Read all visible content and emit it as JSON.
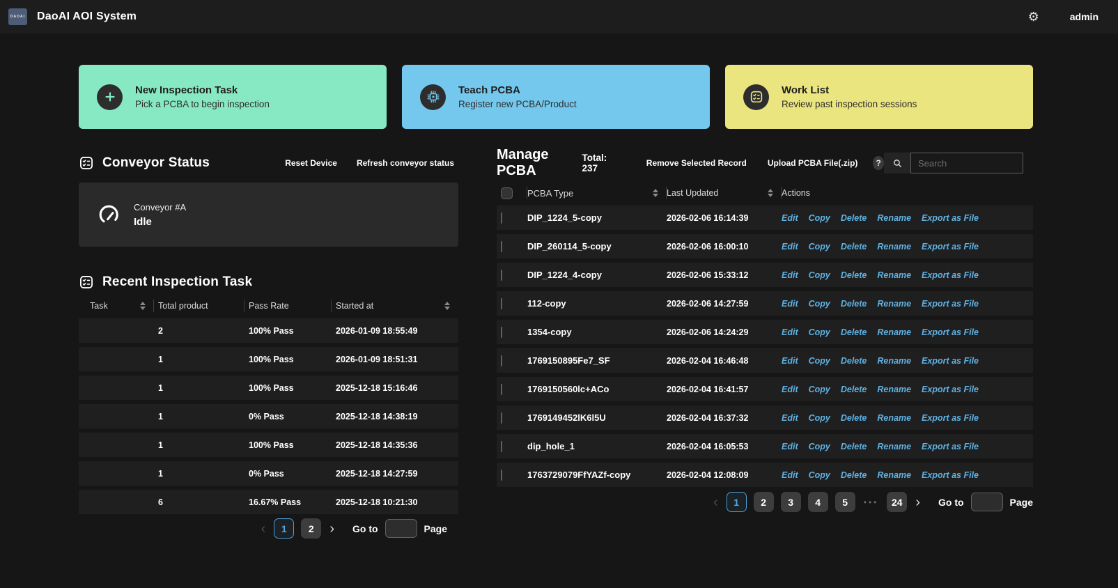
{
  "header": {
    "logo_text": "DAOAI",
    "title": "DaoAI AOI System",
    "user": "admin"
  },
  "icons": {
    "gear": "⚙",
    "help": "?",
    "prev": "‹",
    "next": "›"
  },
  "cards": [
    {
      "title": "New Inspection Task",
      "subtitle": "Pick a PCBA to begin inspection",
      "bg": "#87e9c3"
    },
    {
      "title": "Teach PCBA",
      "subtitle": "Register new PCBA/Product",
      "bg": "#74c8ed"
    },
    {
      "title": "Work List",
      "subtitle": "Review past inspection sessions",
      "bg": "#ebe57f"
    }
  ],
  "conveyor": {
    "heading": "Conveyor Status",
    "reset_label": "Reset Device",
    "refresh_label": "Refresh conveyor status",
    "device_name": "Conveyor #A",
    "device_status": "Idle"
  },
  "recent": {
    "heading": "Recent Inspection Task",
    "columns": [
      "Task",
      "Total product",
      "Pass Rate",
      "Started at"
    ],
    "rows": [
      {
        "task": "",
        "total": "2",
        "rate": "100% Pass",
        "started": "2026-01-09 18:55:49"
      },
      {
        "task": "",
        "total": "1",
        "rate": "100% Pass",
        "started": "2026-01-09 18:51:31"
      },
      {
        "task": "",
        "total": "1",
        "rate": "100% Pass",
        "started": "2025-12-18 15:16:46"
      },
      {
        "task": "",
        "total": "1",
        "rate": "0% Pass",
        "started": "2025-12-18 14:38:19"
      },
      {
        "task": "",
        "total": "1",
        "rate": "100% Pass",
        "started": "2025-12-18 14:35:36"
      },
      {
        "task": "",
        "total": "1",
        "rate": "0% Pass",
        "started": "2025-12-18 14:27:59"
      },
      {
        "task": "",
        "total": "6",
        "rate": "16.67% Pass",
        "started": "2025-12-18 10:21:30"
      }
    ],
    "pagination": {
      "pages": [
        "1",
        "2"
      ],
      "active_page": "1",
      "goto_label": "Go to",
      "page_label": "Page"
    }
  },
  "manage": {
    "heading": "Manage PCBA",
    "total_label": "Total: 237",
    "remove_label": "Remove Selected Record",
    "upload_label": "Upload PCBA File(.zip)",
    "search_placeholder": "Search",
    "columns": [
      "PCBA Type",
      "Last Updated",
      "Actions"
    ],
    "action_labels": [
      "Edit",
      "Copy",
      "Delete",
      "Rename",
      "Export as File"
    ],
    "rows": [
      {
        "name": "DIP_1224_5-copy",
        "updated": "2026-02-06 16:14:39"
      },
      {
        "name": "DIP_260114_5-copy",
        "updated": "2026-02-06 16:00:10"
      },
      {
        "name": "DIP_1224_4-copy",
        "updated": "2026-02-06 15:33:12"
      },
      {
        "name": "112-copy",
        "updated": "2026-02-06 14:27:59"
      },
      {
        "name": "1354-copy",
        "updated": "2026-02-06 14:24:29"
      },
      {
        "name": "1769150895Fe7_SF",
        "updated": "2026-02-04 16:46:48"
      },
      {
        "name": "1769150560lc+ACo",
        "updated": "2026-02-04 16:41:57"
      },
      {
        "name": "1769149452lK6l5U",
        "updated": "2026-02-04 16:37:32"
      },
      {
        "name": "dip_hole_1",
        "updated": "2026-02-04 16:05:53"
      },
      {
        "name": "1763729079FfYAZf-copy",
        "updated": "2026-02-04 12:08:09"
      }
    ],
    "pagination": {
      "pages": [
        "1",
        "2",
        "3",
        "4",
        "5",
        "•••",
        "24"
      ],
      "active_page": "1",
      "goto_label": "Go to",
      "page_label": "Page"
    }
  },
  "colors": {
    "card_green": "#87e9c3",
    "card_blue": "#74c8ed",
    "card_yellow": "#ebe57f",
    "action_link": "#5fb2e4",
    "active_page": "#4aa0d6"
  }
}
